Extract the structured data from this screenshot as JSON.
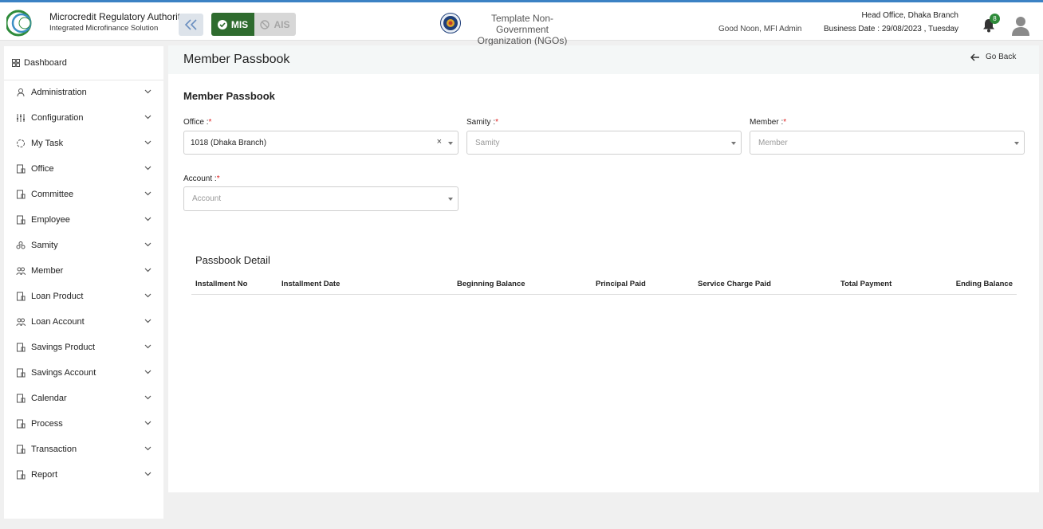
{
  "header": {
    "brand_title": "Microcredit Regulatory Authority",
    "brand_subtitle": "Integrated Microfinance Solution",
    "logo_text": "Microcredit Regulatory Authority",
    "mode_mis": "MIS",
    "mode_ais": "AIS",
    "org_line1": "Template Non-Government",
    "org_line2": "Organization (NGOs)",
    "greeting": "Good Noon, MFI Admin",
    "head_office": "Head Office, Dhaka Branch",
    "business_date": "Business Date : 29/08/2023 , Tuesday",
    "notification_count": "8"
  },
  "sidebar": {
    "dashboard": "Dashboard",
    "items": [
      {
        "label": "Administration",
        "icon": "admin-icon"
      },
      {
        "label": "Configuration",
        "icon": "sliders-icon"
      },
      {
        "label": "My Task",
        "icon": "task-icon"
      },
      {
        "label": "Office",
        "icon": "office-icon"
      },
      {
        "label": "Committee",
        "icon": "committee-icon"
      },
      {
        "label": "Employee",
        "icon": "employee-icon"
      },
      {
        "label": "Samity",
        "icon": "samity-icon"
      },
      {
        "label": "Member",
        "icon": "member-icon"
      },
      {
        "label": "Loan Product",
        "icon": "loan-product-icon"
      },
      {
        "label": "Loan Account",
        "icon": "loan-account-icon"
      },
      {
        "label": "Savings Product",
        "icon": "savings-product-icon"
      },
      {
        "label": "Savings Account",
        "icon": "savings-account-icon"
      },
      {
        "label": "Calendar",
        "icon": "calendar-icon"
      },
      {
        "label": "Process",
        "icon": "process-icon"
      },
      {
        "label": "Transaction",
        "icon": "transaction-icon"
      },
      {
        "label": "Report",
        "icon": "report-icon"
      }
    ]
  },
  "page": {
    "title": "Member Passbook",
    "go_back": "Go Back",
    "section_title": "Member Passbook"
  },
  "form": {
    "office": {
      "label": "Office :",
      "required": "*",
      "value": "1018 (Dhaka Branch)",
      "clear": "×"
    },
    "samity": {
      "label": "Samity :",
      "required": "*",
      "placeholder": "Samity"
    },
    "member": {
      "label": "Member :",
      "required": "*",
      "placeholder": "Member"
    },
    "account": {
      "label": "Account :",
      "required": "*",
      "placeholder": "Account"
    }
  },
  "passbook": {
    "title": "Passbook Detail",
    "columns": [
      "Installment No",
      "Installment Date",
      "Beginning Balance",
      "Principal Paid",
      "Service Charge Paid",
      "Total Payment",
      "Ending Balance"
    ]
  },
  "colors": {
    "mis_active": "#2e6b2e",
    "ais_inactive": "#d7d7d7",
    "required": "#dd2222",
    "badge": "#2e8b3a"
  }
}
